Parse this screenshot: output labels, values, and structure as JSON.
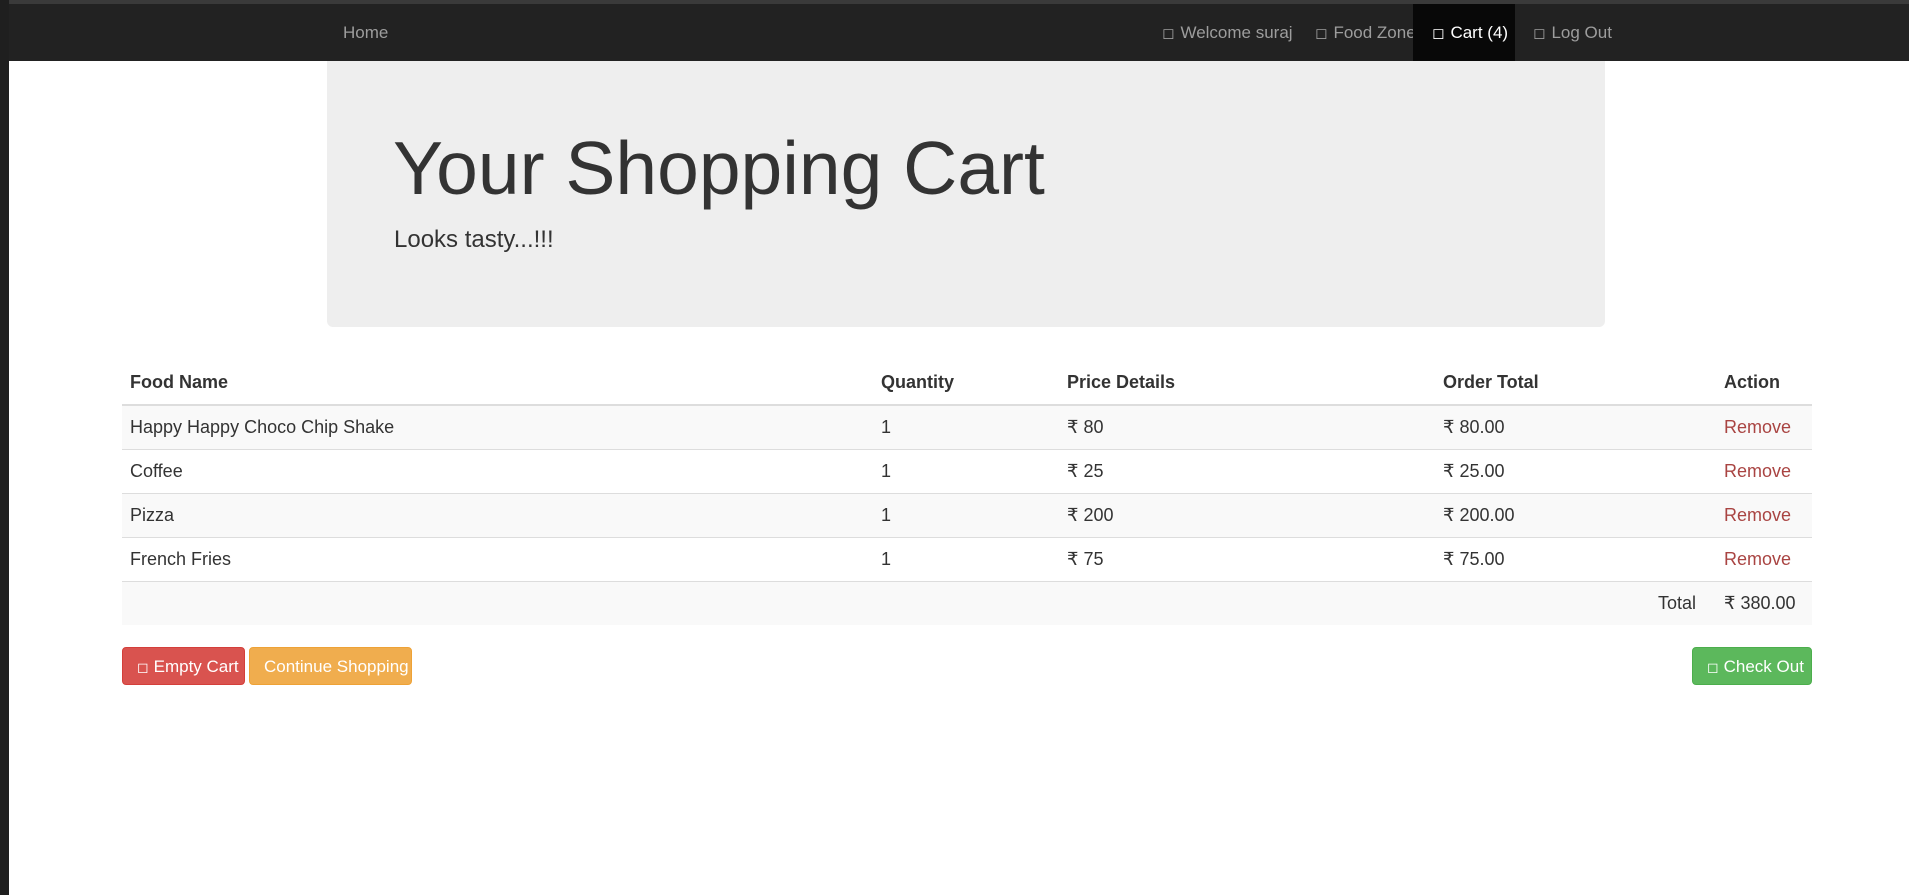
{
  "nav": {
    "home": "Home",
    "welcome": "Welcome suraj",
    "food_zone": "Food Zone",
    "cart": "Cart (4)",
    "logout": "Log Out",
    "icons": {
      "welcome": "user-icon",
      "food_zone": "cutlery-icon",
      "cart": "shopping-cart-icon",
      "logout": "log-out-icon"
    }
  },
  "jumbotron": {
    "title": "Your Shopping Cart",
    "subtitle": "Looks tasty...!!!"
  },
  "table": {
    "headers": [
      "Food Name",
      "Quantity",
      "Price Details",
      "Order Total",
      "Action"
    ],
    "rows": [
      {
        "name": "Happy Happy Choco Chip Shake",
        "quantity": "1",
        "price": "₹ 80",
        "order_total": "₹ 80.00",
        "action": "Remove"
      },
      {
        "name": "Coffee",
        "quantity": "1",
        "price": "₹ 25",
        "order_total": "₹ 25.00",
        "action": "Remove"
      },
      {
        "name": "Pizza",
        "quantity": "1",
        "price": "₹ 200",
        "order_total": "₹ 200.00",
        "action": "Remove"
      },
      {
        "name": "French Fries",
        "quantity": "1",
        "price": "₹ 75",
        "order_total": "₹ 75.00",
        "action": "Remove"
      }
    ],
    "total_label": "Total",
    "total_value": "₹ 380.00"
  },
  "buttons": {
    "empty_cart": "Empty Cart",
    "continue_shopping": "Continue Shopping",
    "check_out": "Check Out"
  },
  "colors": {
    "navbar": "#222222",
    "jumbotron": "#eeeeee",
    "danger": "#d9534f",
    "warning": "#f0ad4e",
    "success": "#5cb85c",
    "remove_link": "#a94442"
  }
}
